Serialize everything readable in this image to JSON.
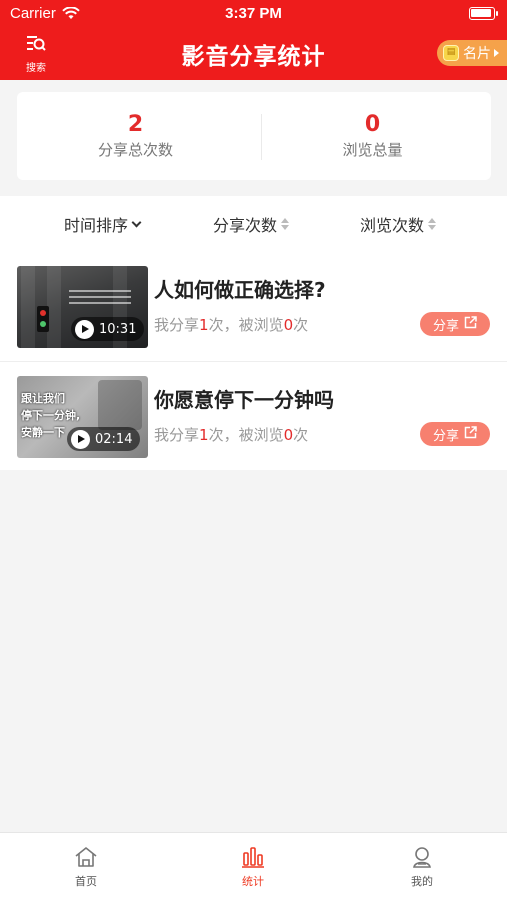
{
  "status_bar": {
    "carrier": "Carrier",
    "time": "3:37 PM"
  },
  "header": {
    "search_label": "搜索",
    "title": "影音分享统计",
    "card_label": "名片"
  },
  "summary": {
    "total_shares_value": "2",
    "total_shares_label": "分享总次数",
    "total_views_value": "0",
    "total_views_label": "浏览总量"
  },
  "sort": {
    "time": "时间排序",
    "shares": "分享次数",
    "views": "浏览次数"
  },
  "videos": [
    {
      "title": "人如何做正确选择?",
      "duration": "10:31",
      "stats_prefix": "我分享",
      "share_count": "1",
      "stats_mid": "次，被浏览",
      "view_count": "0",
      "stats_suffix": "次",
      "share_label": "分享"
    },
    {
      "title": "你愿意停下一分钟吗",
      "duration": "02:14",
      "thumb_text": [
        "跟让我们",
        "停下一分钟,",
        "安静一下"
      ],
      "stats_prefix": "我分享",
      "share_count": "1",
      "stats_mid": "次，被浏览",
      "view_count": "0",
      "stats_suffix": "次",
      "share_label": "分享"
    }
  ],
  "tabbar": {
    "home": "首页",
    "stats": "统计",
    "mine": "我的"
  },
  "colors": {
    "brand_red": "#ee1c1c",
    "accent_red": "#e32b2b",
    "share_button": "#f7806f",
    "card_button": "#f5a24a"
  },
  "icons": [
    "wifi-icon",
    "battery-icon",
    "search-icon",
    "card-icon",
    "chevron-down-icon",
    "sort-icon",
    "play-icon",
    "external-link-icon",
    "home-icon",
    "stats-icon",
    "profile-icon"
  ]
}
